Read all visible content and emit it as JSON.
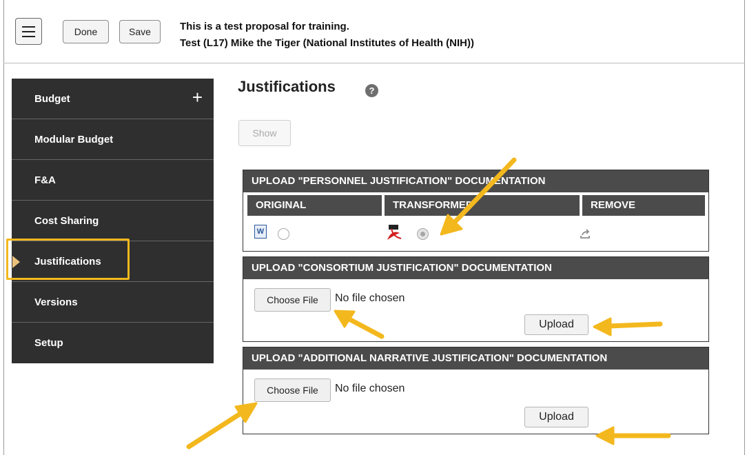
{
  "header": {
    "menu_icon": "hamburger-menu-icon",
    "done_label": "Done",
    "save_label": "Save",
    "proposal_line1": "This is a test proposal for training.",
    "proposal_line2": "Test (L17) Mike the Tiger (National Institutes of Health (NIH))"
  },
  "sidebar": {
    "items": [
      {
        "label": "Budget",
        "icon": "plus-icon"
      },
      {
        "label": "Modular Budget"
      },
      {
        "label": "F&A"
      },
      {
        "label": "Cost Sharing"
      },
      {
        "label": "Justifications",
        "active": true
      },
      {
        "label": "Versions"
      },
      {
        "label": "Setup"
      }
    ]
  },
  "main": {
    "title": "Justifications",
    "help_icon_glyph": "?",
    "show_label": "Show",
    "personnel": {
      "heading": "UPLOAD \"PERSONNEL JUSTIFICATION\" DOCUMENTATION",
      "col_original": "ORIGINAL",
      "col_transformed": "TRANSFORMED",
      "col_remove": "REMOVE"
    },
    "consortium": {
      "heading": "UPLOAD \"CONSORTIUM JUSTIFICATION\" DOCUMENTATION",
      "choose_label": "Choose File",
      "no_file": "No file chosen",
      "upload_label": "Upload"
    },
    "additional": {
      "heading": "UPLOAD \"ADDITIONAL NARRATIVE JUSTIFICATION\" DOCUMENTATION",
      "choose_label": "Choose File",
      "no_file": "No file chosen",
      "upload_label": "Upload"
    }
  },
  "colors": {
    "sidebar_bg": "#2f2f2f",
    "panel_header_bg": "#4b4b4b",
    "highlight": "#f3b81e",
    "annotation_arrow": "#f3b81e"
  }
}
